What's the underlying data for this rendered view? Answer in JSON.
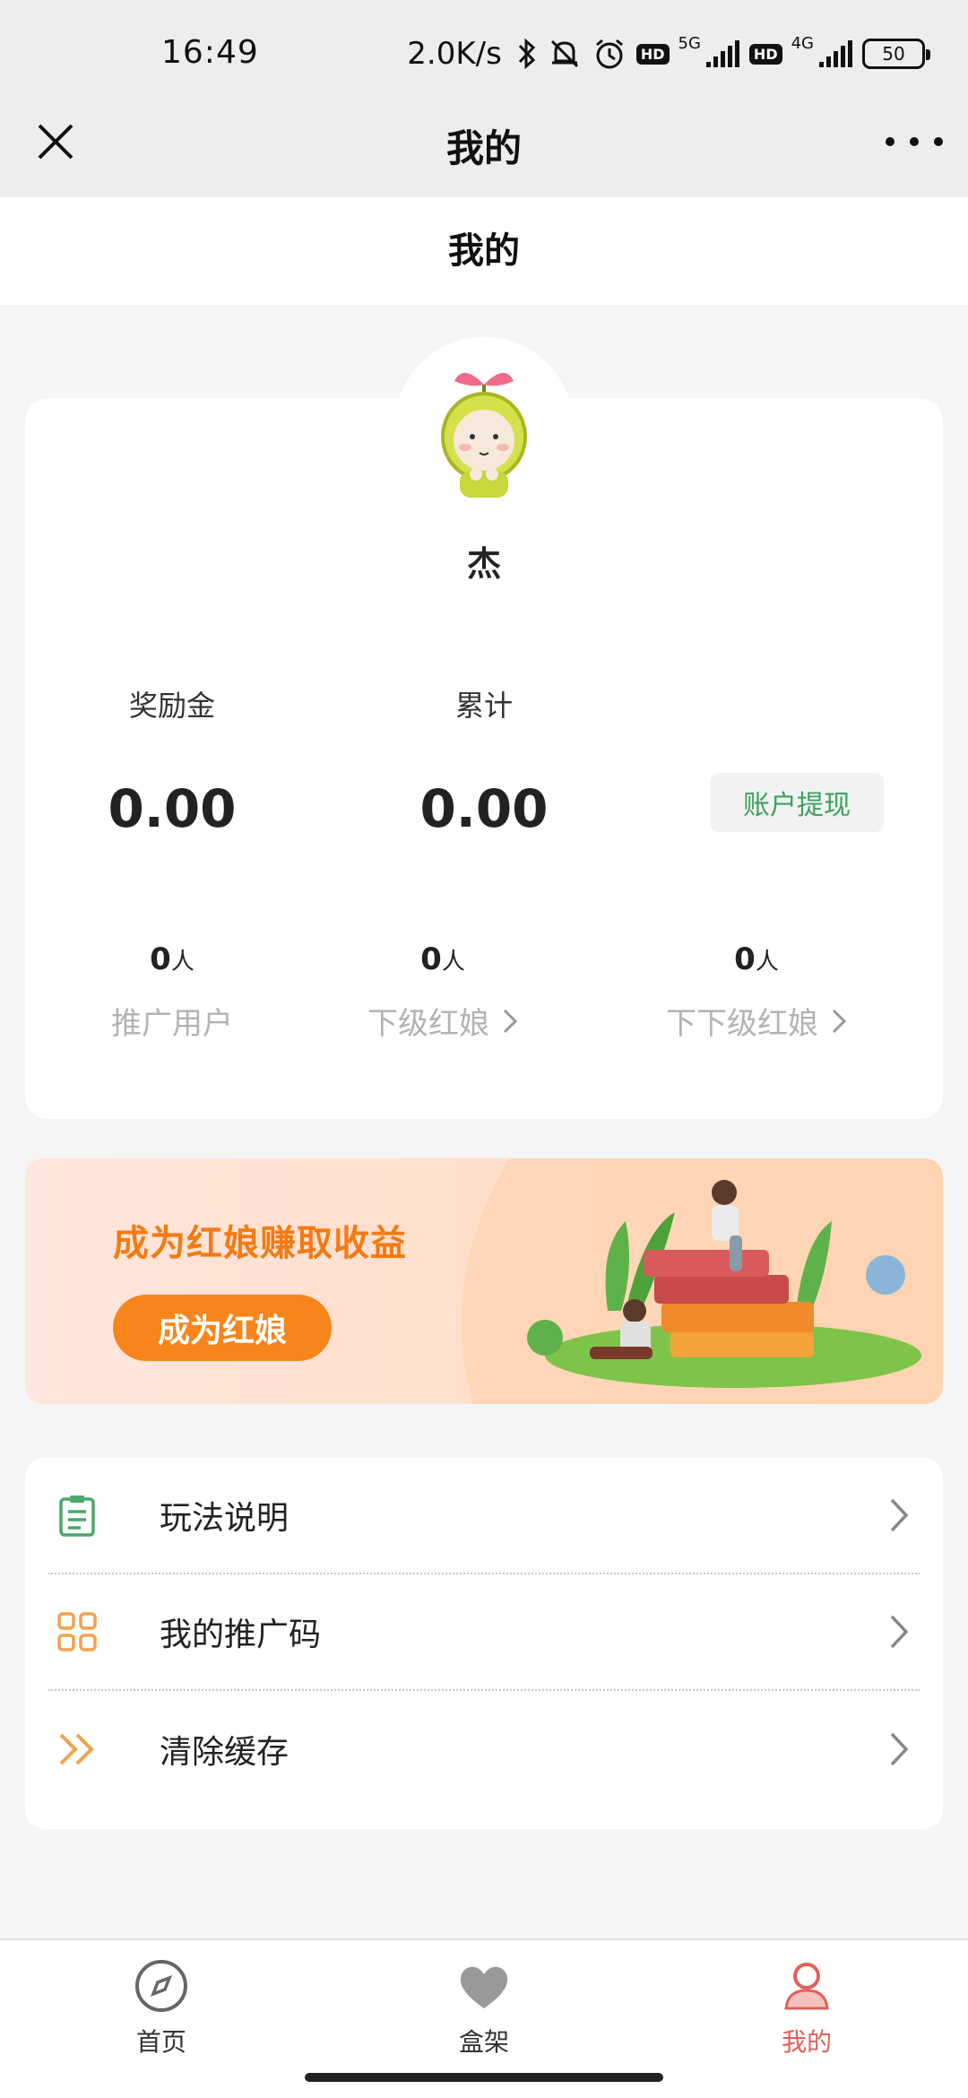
{
  "status_bar": {
    "time": "16:49",
    "speed": "2.0K/s",
    "network_1": "5G",
    "network_2": "4G",
    "hd": "HD",
    "battery": "50"
  },
  "header": {
    "title": "我的",
    "close_icon": "close-icon",
    "more_icon": "more-icon"
  },
  "page": {
    "title": "我的"
  },
  "profile": {
    "name": "杰",
    "bonus_label": "奖励金",
    "bonus_value": "0.00",
    "total_label": "累计",
    "total_value": "0.00",
    "withdraw_label": "账户提现",
    "counts": [
      {
        "value": "0",
        "unit": "人",
        "label": "推广用户"
      },
      {
        "value": "0",
        "unit": "人",
        "label": "下级红娘"
      },
      {
        "value": "0",
        "unit": "人",
        "label": "下下级红娘"
      }
    ]
  },
  "banner": {
    "title": "成为红娘赚取收益",
    "button": "成为红娘"
  },
  "menu": {
    "items": [
      {
        "label": "玩法说明",
        "icon": "clipboard-icon"
      },
      {
        "label": "我的推广码",
        "icon": "grid-icon"
      },
      {
        "label": "清除缓存",
        "icon": "double-chevron-icon"
      }
    ]
  },
  "tabs": [
    {
      "label": "首页",
      "icon": "compass-icon"
    },
    {
      "label": "盒架",
      "icon": "heart-icon"
    },
    {
      "label": "我的",
      "icon": "user-icon"
    }
  ],
  "colors": {
    "accent_orange": "#f7851a",
    "green_text": "#3aa35a",
    "active_tab": "#e0605a"
  }
}
